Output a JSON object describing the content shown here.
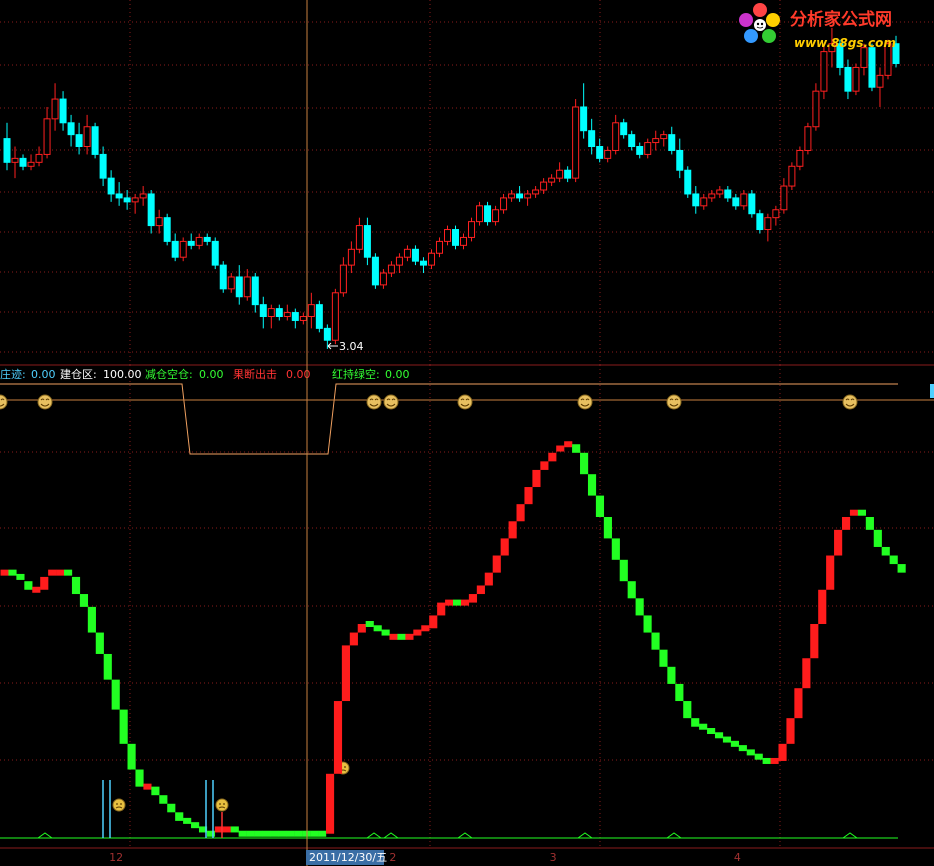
{
  "watermark": {
    "title": "分析家公式网",
    "url": "www.88gs.com"
  },
  "upper_chart": {
    "low_annotation": "3.04",
    "price_ohlc": [
      [
        5.7,
        5.9,
        5.3,
        5.4
      ],
      [
        5.4,
        5.6,
        5.2,
        5.45
      ],
      [
        5.45,
        5.5,
        5.3,
        5.35
      ],
      [
        5.35,
        5.5,
        5.3,
        5.4
      ],
      [
        5.4,
        5.6,
        5.35,
        5.5
      ],
      [
        5.5,
        6.1,
        5.45,
        5.95
      ],
      [
        5.95,
        6.4,
        5.8,
        6.2
      ],
      [
        6.2,
        6.3,
        5.8,
        5.9
      ],
      [
        5.9,
        6.0,
        5.6,
        5.75
      ],
      [
        5.75,
        5.9,
        5.5,
        5.6
      ],
      [
        5.6,
        6.0,
        5.5,
        5.85
      ],
      [
        5.85,
        5.9,
        5.45,
        5.5
      ],
      [
        5.5,
        5.6,
        5.1,
        5.2
      ],
      [
        5.2,
        5.3,
        4.9,
        5.0
      ],
      [
        5.0,
        5.15,
        4.85,
        4.95
      ],
      [
        4.95,
        5.05,
        4.8,
        4.9
      ],
      [
        4.9,
        5.0,
        4.75,
        4.95
      ],
      [
        4.95,
        5.1,
        4.85,
        5.0
      ],
      [
        5.0,
        5.05,
        4.5,
        4.6
      ],
      [
        4.6,
        4.8,
        4.5,
        4.7
      ],
      [
        4.7,
        4.75,
        4.35,
        4.4
      ],
      [
        4.4,
        4.5,
        4.15,
        4.2
      ],
      [
        4.2,
        4.45,
        4.15,
        4.4
      ],
      [
        4.4,
        4.5,
        4.3,
        4.35
      ],
      [
        4.35,
        4.5,
        4.3,
        4.45
      ],
      [
        4.45,
        4.5,
        4.35,
        4.4
      ],
      [
        4.4,
        4.45,
        4.05,
        4.1
      ],
      [
        4.1,
        4.15,
        3.75,
        3.8
      ],
      [
        3.8,
        4.0,
        3.75,
        3.95
      ],
      [
        3.95,
        4.1,
        3.6,
        3.7
      ],
      [
        3.7,
        4.05,
        3.65,
        3.95
      ],
      [
        3.95,
        4.0,
        3.5,
        3.6
      ],
      [
        3.6,
        3.7,
        3.3,
        3.45
      ],
      [
        3.45,
        3.6,
        3.3,
        3.55
      ],
      [
        3.55,
        3.6,
        3.4,
        3.45
      ],
      [
        3.45,
        3.6,
        3.4,
        3.5
      ],
      [
        3.5,
        3.55,
        3.3,
        3.4
      ],
      [
        3.4,
        3.5,
        3.35,
        3.45
      ],
      [
        3.45,
        3.75,
        3.3,
        3.6
      ],
      [
        3.6,
        3.65,
        3.25,
        3.3
      ],
      [
        3.3,
        3.35,
        3.04,
        3.15
      ],
      [
        3.15,
        3.8,
        3.1,
        3.75
      ],
      [
        3.75,
        4.2,
        3.7,
        4.1
      ],
      [
        4.1,
        4.4,
        4.0,
        4.3
      ],
      [
        4.3,
        4.7,
        4.25,
        4.6
      ],
      [
        4.6,
        4.7,
        4.1,
        4.2
      ],
      [
        4.2,
        4.25,
        3.8,
        3.85
      ],
      [
        3.85,
        4.05,
        3.8,
        4.0
      ],
      [
        4.0,
        4.15,
        3.95,
        4.1
      ],
      [
        4.1,
        4.25,
        4.0,
        4.2
      ],
      [
        4.2,
        4.35,
        4.15,
        4.3
      ],
      [
        4.3,
        4.35,
        4.1,
        4.15
      ],
      [
        4.15,
        4.2,
        4.0,
        4.1
      ],
      [
        4.1,
        4.3,
        4.05,
        4.25
      ],
      [
        4.25,
        4.45,
        4.2,
        4.4
      ],
      [
        4.4,
        4.6,
        4.35,
        4.55
      ],
      [
        4.55,
        4.6,
        4.3,
        4.35
      ],
      [
        4.35,
        4.5,
        4.3,
        4.45
      ],
      [
        4.45,
        4.7,
        4.4,
        4.65
      ],
      [
        4.65,
        4.9,
        4.6,
        4.85
      ],
      [
        4.85,
        4.9,
        4.6,
        4.65
      ],
      [
        4.65,
        4.85,
        4.6,
        4.8
      ],
      [
        4.8,
        5.0,
        4.75,
        4.95
      ],
      [
        4.95,
        5.05,
        4.9,
        5.0
      ],
      [
        5.0,
        5.1,
        4.9,
        4.95
      ],
      [
        4.95,
        5.05,
        4.85,
        5.0
      ],
      [
        5.0,
        5.1,
        4.95,
        5.05
      ],
      [
        5.05,
        5.2,
        5.0,
        5.15
      ],
      [
        5.15,
        5.25,
        5.1,
        5.2
      ],
      [
        5.2,
        5.4,
        5.15,
        5.3
      ],
      [
        5.3,
        5.35,
        5.15,
        5.2
      ],
      [
        5.2,
        6.2,
        5.15,
        6.1
      ],
      [
        6.1,
        6.4,
        5.7,
        5.8
      ],
      [
        5.8,
        5.95,
        5.5,
        5.6
      ],
      [
        5.6,
        5.7,
        5.4,
        5.45
      ],
      [
        5.45,
        5.6,
        5.4,
        5.55
      ],
      [
        5.55,
        6.0,
        5.5,
        5.9
      ],
      [
        5.9,
        5.95,
        5.7,
        5.75
      ],
      [
        5.75,
        5.8,
        5.55,
        5.6
      ],
      [
        5.6,
        5.65,
        5.45,
        5.5
      ],
      [
        5.5,
        5.7,
        5.45,
        5.65
      ],
      [
        5.65,
        5.8,
        5.55,
        5.7
      ],
      [
        5.7,
        5.8,
        5.6,
        5.75
      ],
      [
        5.75,
        5.85,
        5.5,
        5.55
      ],
      [
        5.55,
        5.7,
        5.2,
        5.3
      ],
      [
        5.3,
        5.35,
        4.95,
        5.0
      ],
      [
        5.0,
        5.1,
        4.75,
        4.85
      ],
      [
        4.85,
        5.0,
        4.8,
        4.95
      ],
      [
        4.95,
        5.05,
        4.9,
        5.0
      ],
      [
        5.0,
        5.1,
        4.95,
        5.05
      ],
      [
        5.05,
        5.1,
        4.9,
        4.95
      ],
      [
        4.95,
        5.0,
        4.8,
        4.85
      ],
      [
        4.85,
        5.05,
        4.8,
        5.0
      ],
      [
        5.0,
        5.05,
        4.7,
        4.75
      ],
      [
        4.75,
        4.8,
        4.5,
        4.55
      ],
      [
        4.55,
        4.75,
        4.4,
        4.7
      ],
      [
        4.7,
        4.85,
        4.6,
        4.8
      ],
      [
        4.8,
        5.2,
        4.75,
        5.1
      ],
      [
        5.1,
        5.4,
        5.05,
        5.35
      ],
      [
        5.35,
        5.6,
        5.3,
        5.55
      ],
      [
        5.55,
        5.9,
        5.5,
        5.85
      ],
      [
        5.85,
        6.4,
        5.8,
        6.3
      ],
      [
        6.3,
        6.9,
        6.2,
        6.8
      ],
      [
        6.8,
        7.1,
        6.6,
        6.9
      ],
      [
        6.9,
        6.95,
        6.5,
        6.6
      ],
      [
        6.6,
        6.7,
        6.2,
        6.3
      ],
      [
        6.3,
        6.65,
        6.25,
        6.6
      ],
      [
        6.6,
        6.9,
        6.5,
        6.85
      ],
      [
        6.85,
        6.9,
        6.3,
        6.35
      ],
      [
        6.35,
        6.6,
        6.1,
        6.5
      ],
      [
        6.5,
        6.95,
        6.45,
        6.9
      ],
      [
        6.9,
        7.0,
        6.6,
        6.65
      ]
    ]
  },
  "lower_chart": {
    "indicators": [
      {
        "label": "庄迹:",
        "value": "0.00"
      },
      {
        "label": "建仓区:",
        "value": "100.00"
      },
      {
        "label": "减仓空仓:",
        "value": "0.00"
      },
      {
        "label": "果断出击",
        "value": "0.00"
      },
      {
        "label": "红持绿空:",
        "value": "0.00"
      }
    ],
    "series_values": [
      62,
      61,
      60,
      58,
      58,
      61,
      62,
      62,
      61,
      57,
      54,
      48,
      43,
      37,
      30,
      22,
      16,
      12,
      12,
      10,
      8,
      6,
      4,
      3,
      2,
      1,
      1,
      2,
      2,
      1,
      1,
      1,
      1,
      1,
      1,
      1,
      1,
      1,
      1,
      1,
      1,
      15,
      32,
      45,
      48,
      50,
      49,
      48,
      47,
      47,
      46,
      47,
      48,
      49,
      52,
      55,
      55,
      54,
      55,
      57,
      59,
      62,
      66,
      70,
      74,
      78,
      82,
      86,
      88,
      90,
      91,
      92,
      90,
      85,
      80,
      75,
      70,
      65,
      60,
      56,
      52,
      48,
      44,
      40,
      36,
      32,
      28,
      26,
      25,
      24,
      23,
      22,
      21,
      20,
      19,
      18,
      17,
      18,
      22,
      28,
      35,
      42,
      50,
      58,
      66,
      72,
      75,
      76,
      75,
      72,
      68,
      66,
      64,
      62
    ]
  },
  "time_axis": {
    "labels": [
      {
        "text": "12",
        "bar_index": 13
      },
      {
        "text": "2011/12/30/五",
        "bar_index": 34
      },
      {
        "text": "2",
        "bar_index": 48
      },
      {
        "text": "3",
        "bar_index": 68
      },
      {
        "text": "4",
        "bar_index": 91
      }
    ]
  },
  "colors": {
    "up_candle": "#ff2020",
    "down_candle": "#00ffff",
    "indicator_red": "#ff1c1c",
    "indicator_green": "#22ff22",
    "grid": "#8a1d1d",
    "crosshair": "#c87f3f",
    "label_white": "#ffffff",
    "label_zhuangji": "#4fd0ff",
    "label_jiancang": "#ffffff",
    "label_jiancangkong": "#33ff33",
    "label_guoduan": "#ff3333",
    "label_hongchi": "#33ff33"
  }
}
